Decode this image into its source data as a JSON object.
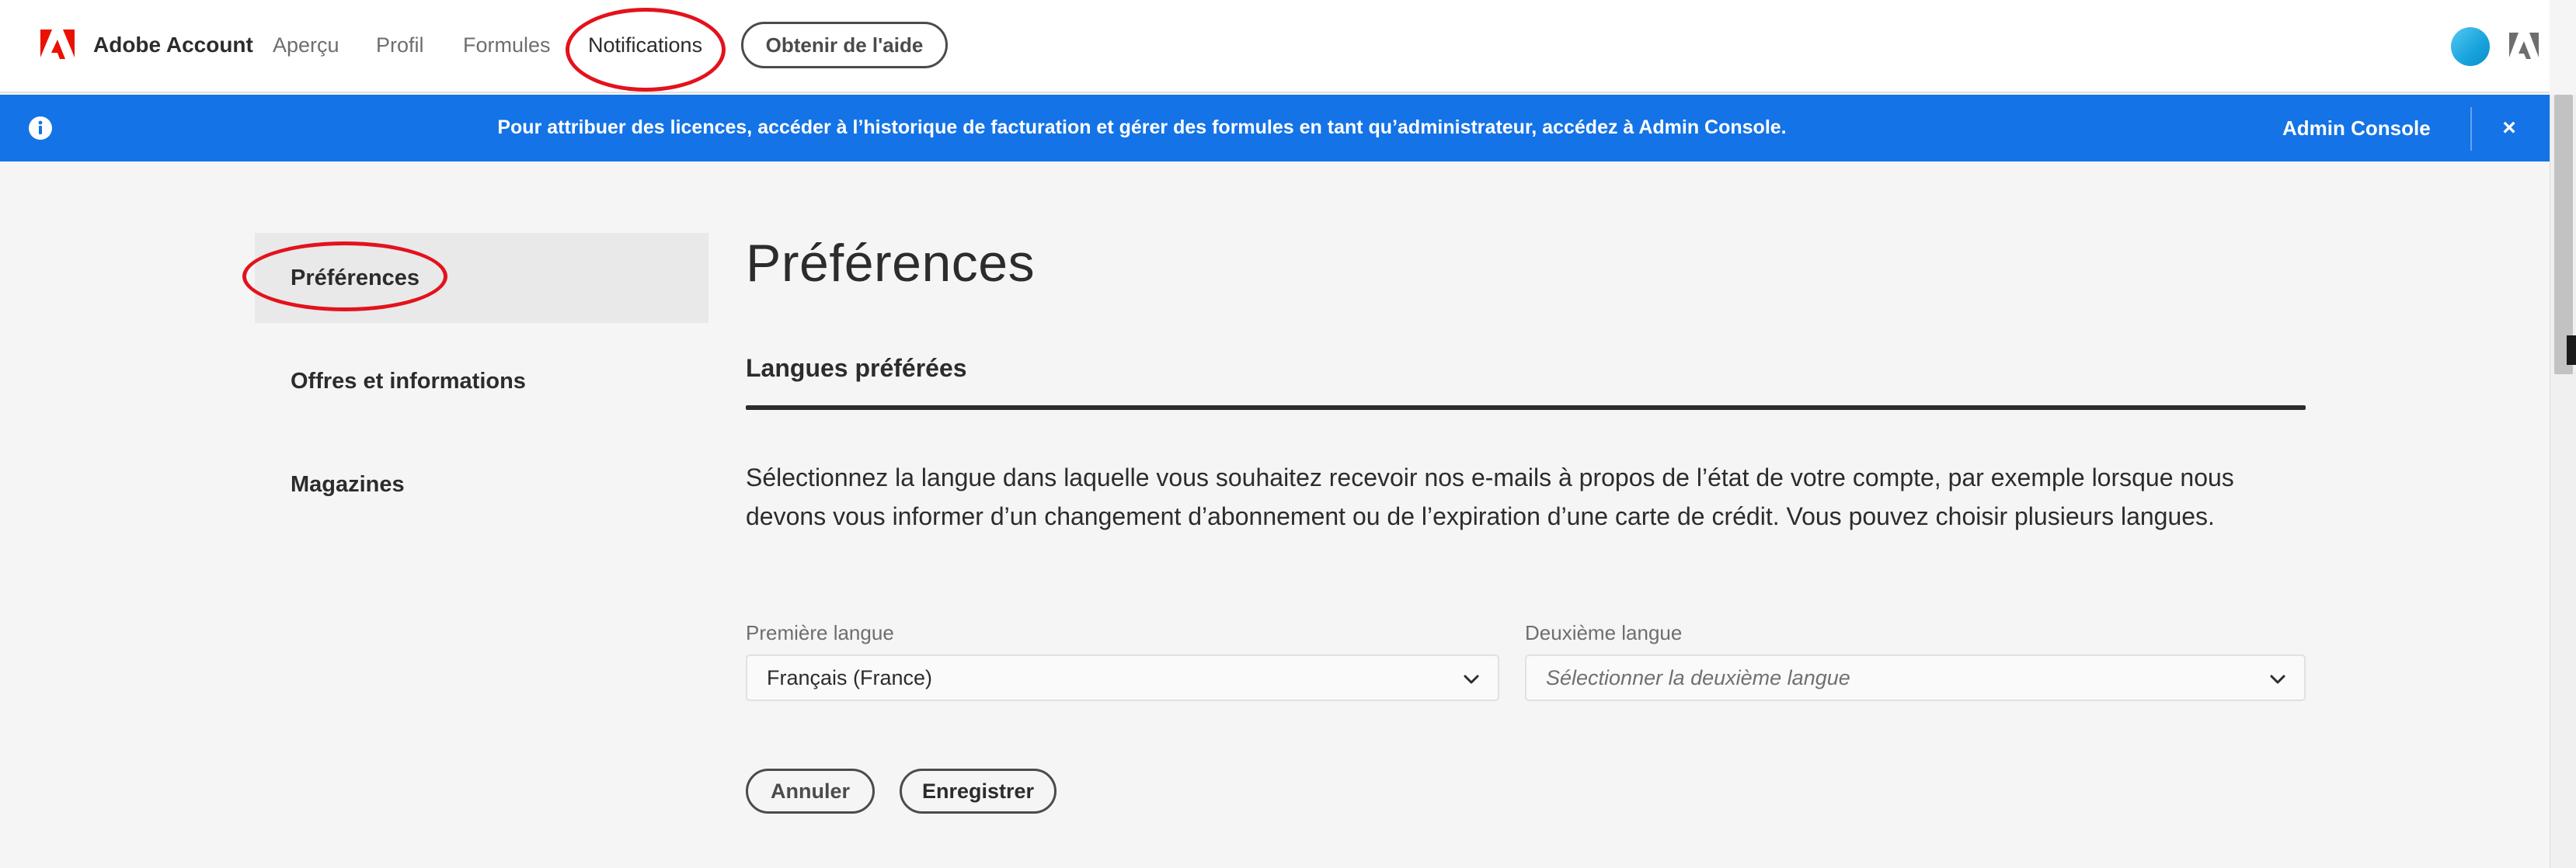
{
  "header": {
    "brand": "Adobe Account",
    "nav": [
      "Aperçu",
      "Profil",
      "Formules",
      "Notifications"
    ],
    "help_button": "Obtenir de l'aide"
  },
  "banner": {
    "message": "Pour attribuer des licences, accéder à l’historique de facturation et gérer des formules en tant qu’administrateur, accédez à Admin Console.",
    "link": "Admin Console",
    "close": "×"
  },
  "sidebar": {
    "items": [
      "Préférences",
      "Offres et informations",
      "Magazines"
    ]
  },
  "main": {
    "title": "Préférences",
    "section_title": "Langues préférées",
    "description": "Sélectionnez la langue dans laquelle vous souhaitez recevoir nos e-mails à propos de l’état de votre compte, par exemple lorsque nous devons vous informer d’un changement d’abonnement ou de l’expiration d’une carte de crédit. Vous pouvez choisir plusieurs langues.",
    "first_language_label": "Première langue",
    "first_language_value": "Français (France)",
    "second_language_label": "Deuxième langue",
    "second_language_placeholder": "Sélectionner la deuxième langue",
    "cancel_button": "Annuler",
    "save_button": "Enregistrer"
  },
  "colors": {
    "banner": "#1473e6",
    "annotation": "#e3121c",
    "adobe_red": "#eb1000"
  }
}
